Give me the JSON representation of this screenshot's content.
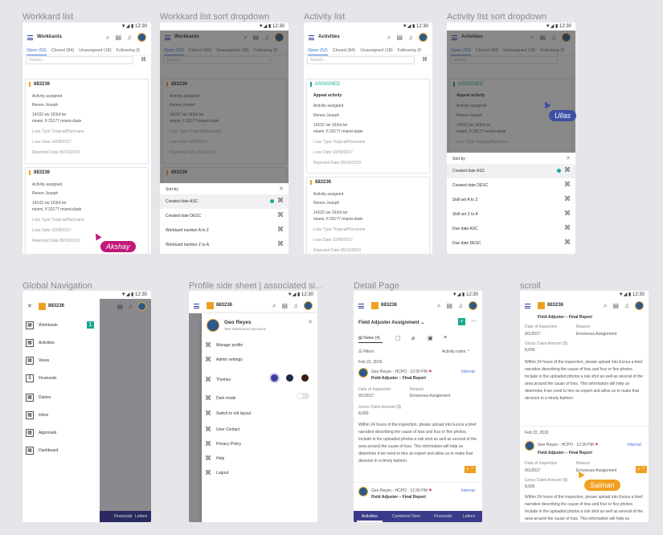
{
  "labels": {
    "f1": "Workkard list",
    "f2": "Workkard list sort dropdown",
    "f3": "Activity list",
    "f4": "Activity list sort dropdown",
    "f5": "Global Navigation",
    "f6": "Profile side sheet | associated si...",
    "f7": "Detail Page",
    "f8": "scroll"
  },
  "status": {
    "time": "12:30"
  },
  "app": {
    "workkards_title": "Workkards",
    "activities_title": "Activities",
    "case_id": "883236",
    "search_placeholder": "Search..."
  },
  "tabs": {
    "open": "Open (52)",
    "closed": "Closed (84)",
    "unassigned": "Unassigned (18)",
    "following": "Following (5"
  },
  "card": {
    "id": "883236",
    "assigned": "Activity assigned",
    "name": "Renee Joseph",
    "addr1": "14102 sw 163rd ter",
    "addr2": "miami, fl 33177 miami-dade",
    "loss_type": "Loss Type Tropical/Hurricane",
    "loss_date": "Loss Date 10/09/2017",
    "reported": "Reported Date 05/10/2019"
  },
  "activity_card": {
    "status": "ASSIGNED",
    "title": "Appeal activity"
  },
  "sort": {
    "header": "Sort by",
    "options_wk": [
      "Created date ASC",
      "Created date DESC",
      "Workkard number A to Z",
      "Workkard number Z to A"
    ],
    "options_act": [
      "Created date ASC",
      "Created date DESC",
      "Skill set A to Z",
      "Skill set Z to A",
      "Due date ASC",
      "Due date DESC"
    ]
  },
  "tags": {
    "akshay": "Akshay",
    "ullas": "Ullas",
    "salman": "Salman"
  },
  "tag_colors": {
    "akshay": "#c2187a",
    "ullas": "#3d4fa3",
    "salman": "#f0a020"
  },
  "nav": {
    "items": [
      "Workkards",
      "Activities",
      "Views",
      "Financials",
      "Diaries",
      "Inbox",
      "Approvals",
      "Dashboard"
    ],
    "count": "1"
  },
  "profile": {
    "name": "Geo Reyes",
    "company": "Test Safehouse Insurance",
    "items": [
      "Manage profile",
      "Admin settings",
      "Themes",
      "Dark mode",
      "Switch to old layout",
      "User Contact",
      "Privacy Policy",
      "Help",
      "Logout"
    ],
    "theme_colors": [
      "#3d3f9e",
      "#1c2a4a",
      "#3a1e12"
    ]
  },
  "detail": {
    "title": "Field Adjuster Assignment",
    "tabs": [
      "Notes (4)",
      "Filters"
    ],
    "activity_notes": "Activity notes",
    "date1": "Feb 22, 2019",
    "author": "Geo Reyes - HCPO",
    "time": "12:30 PM",
    "internal": "Internal",
    "report": "Field Adjuster – Final Report",
    "insp_label": "Date of Inspection",
    "insp_value": "9/1/2017",
    "reason_label": "Reason",
    "reason_value": "Erroneous Assignment",
    "claim_label": "Gross Claim Amount ($)",
    "claim_value": "8,000",
    "body": "Within 24 hours of the inspection, please upload into Exoca a brief narrative describing the cause of loss and four or five photos. Include in the uploaded photos a risk shot as well as several of the area around the cause of loss. This information will help us determine if we need to hire an expert and allow us to make that decision in a timely fashion.",
    "bottom_tabs": [
      "Activities",
      "Combined View",
      "Financials",
      "Letters"
    ]
  }
}
